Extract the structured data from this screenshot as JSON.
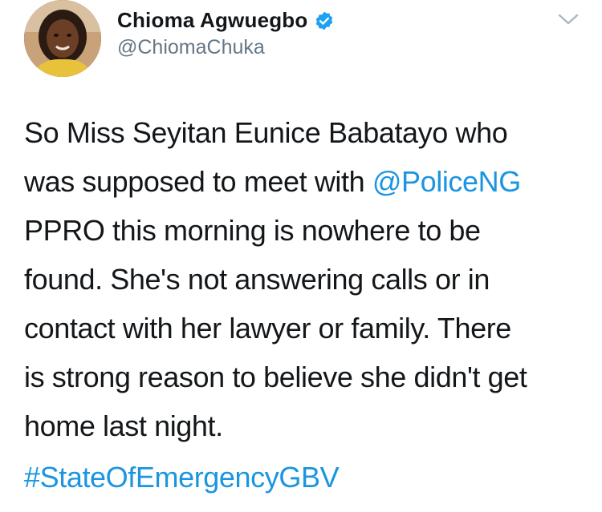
{
  "author": {
    "display_name": "Chioma Agwuegbo",
    "handle": "@ChiomaChuka",
    "verified": true,
    "verified_color": "#1da1f2"
  },
  "tweet": {
    "lines": [
      {
        "pre": "So Miss Seyitan Eunice Babatayo who"
      },
      {
        "pre": "was supposed to meet with ",
        "mention": "@PoliceNG"
      },
      {
        "pre": "PPRO this morning is nowhere to be"
      },
      {
        "pre": "found. She's not answering calls or in"
      },
      {
        "pre": "contact with her lawyer or family. There"
      },
      {
        "pre": "is strong reason to believe she didn't get"
      },
      {
        "pre": "home last night."
      }
    ],
    "hashtag": "#StateOfEmergencyGBV"
  },
  "colors": {
    "link": "#1b95e0",
    "text": "#14171a",
    "secondary": "#657786"
  },
  "icons": {
    "verified": "verified-badge-icon",
    "menu": "chevron-down-icon"
  }
}
